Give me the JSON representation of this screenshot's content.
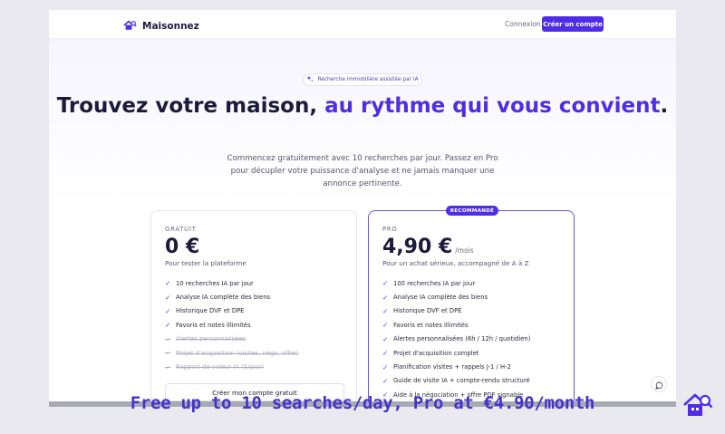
{
  "brand": {
    "name": "Maisonnez",
    "icon": "house-search-icon"
  },
  "nav": {
    "login": "Connexion",
    "signup": "Créer un compte"
  },
  "hero": {
    "pill": "Recherche immobilière assistée par IA",
    "pill_icon": "sparkles-icon",
    "headline_part1": "Trouvez votre maison, ",
    "headline_accent": "au rythme qui vous convient",
    "headline_end": ".",
    "subtitle": "Commencez gratuitement avec 10 recherches par jour. Passez en Pro pour décupler votre puissance d'analyse et ne jamais manquer une annonce pertinente."
  },
  "plans": [
    {
      "name": "GRATUIT",
      "price": "0 €",
      "period": "",
      "description": "Pour tester la plateforme",
      "features": [
        {
          "label": "10 recherches IA par jour",
          "included": true
        },
        {
          "label": "Analyse IA complète des biens",
          "included": true
        },
        {
          "label": "Historique DVF et DPE",
          "included": true
        },
        {
          "label": "Favoris et notes illimités",
          "included": true
        },
        {
          "label": "Alertes personnalisées",
          "included": false
        },
        {
          "label": "Projet d'acquisition (visites, négo, offre)",
          "included": false
        },
        {
          "label": "Rapport de valeur IA (5/jour)",
          "included": false
        }
      ],
      "cta": "Créer mon compte gratuit"
    },
    {
      "name": "PRO",
      "badge": "RECOMMANDÉ",
      "price": "4,90 €",
      "period": "/mois",
      "description": "Pour un achat sérieux, accompagné de A à Z",
      "features": [
        {
          "label": "100 recherches IA par jour",
          "included": true
        },
        {
          "label": "Analyse IA complète des biens",
          "included": true
        },
        {
          "label": "Historique DVF et DPE",
          "included": true
        },
        {
          "label": "Favoris et notes illimités",
          "included": true
        },
        {
          "label": "Alertes personnalisées (6h / 12h / quotidien)",
          "included": true
        },
        {
          "label": "Projet d'acquisition complet",
          "included": true
        },
        {
          "label": "Planification visites + rappels J-1 / H-2",
          "included": true
        },
        {
          "label": "Guide de visite IA + compte-rendu structuré",
          "included": true
        },
        {
          "label": "Aide à la négociation + offre PDF signable",
          "included": true
        }
      ]
    }
  ],
  "chat": {
    "icon": "chat-bubble-icon"
  },
  "caption": "Free up to 10 searches/day, Pro at €4.90/month",
  "colors": {
    "accent": "#4f2de6",
    "text": "#1e1b3a",
    "caption": "#4433cc"
  }
}
